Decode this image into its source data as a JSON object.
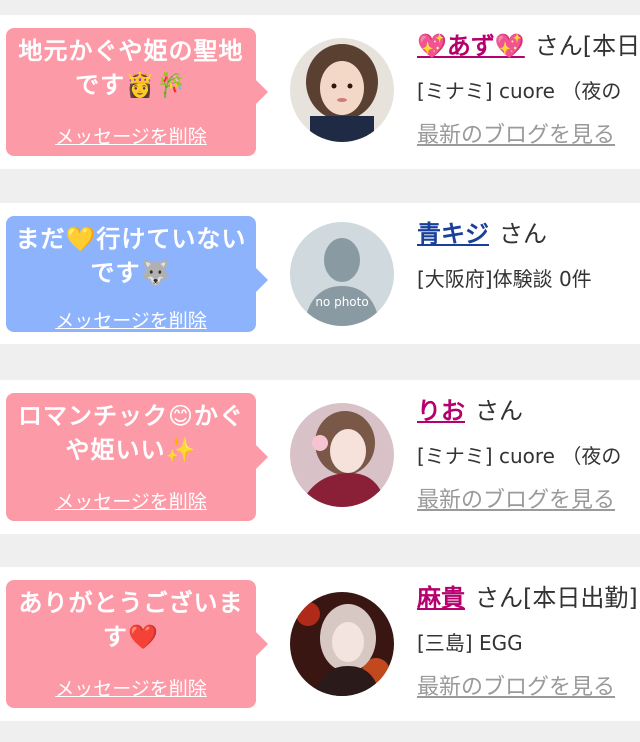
{
  "rows": [
    {
      "message": "地元かぐや姫の聖地です👸🎋",
      "delete_label": "メッセージを削除",
      "name": "💖あず💖",
      "suffix": "さん[本日",
      "shop": "[ミナミ] cuore （夜の",
      "blog_label": "最新のブログを見る",
      "bubble_color": "#fd9aa7"
    },
    {
      "message": "まだ💛行けていないです🐺",
      "delete_label": "メッセージを削除",
      "name": "青キジ",
      "suffix": "さん",
      "shop": "[大阪府]体験談 0件",
      "avatar_text": "no photo",
      "bubble_color": "#8db3fd"
    },
    {
      "message": "ロマンチック😊かぐや姫いい✨",
      "delete_label": "メッセージを削除",
      "name": "りお",
      "suffix": "さん",
      "shop": "[ミナミ] cuore （夜の",
      "blog_label": "最新のブログを見る",
      "bubble_color": "#fd9aa7"
    },
    {
      "message": "ありがとうございます❤️",
      "delete_label": "メッセージを削除",
      "name": "麻貴",
      "suffix": "さん[本日出勤]",
      "shop": "[三島] EGG",
      "blog_label": "最新のブログを見る",
      "bubble_color": "#fd9aa7"
    }
  ]
}
